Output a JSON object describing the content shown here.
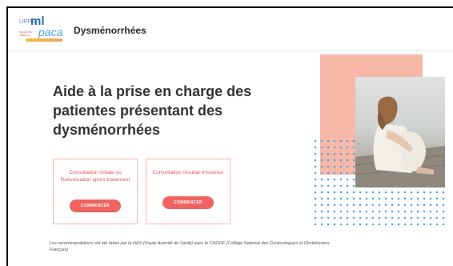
{
  "header": {
    "logo": {
      "urps": "URPS",
      "ml": "ml",
      "paca": "paca",
      "sub": "MÉDECINS LIBÉRAUX"
    },
    "title": "Dysménorrhées"
  },
  "main": {
    "headline": "Aide à la prise en charge des patientes présentant des dysménorrhées",
    "cards": [
      {
        "label": "Consultation initiale ou Réévaluation après traitement",
        "button": "COMMENCER"
      },
      {
        "label": "Consultation résultat d'examen",
        "button": "COMMENCER"
      }
    ],
    "footnote": "Les recommandations ont été faites par la HAS (Haute Autorité de Santé) avec le CNGOF (Collège National des Gynécologues et Obstétriciens Français)"
  },
  "colors": {
    "accent": "#ef6460",
    "card_border": "#f2b7b0",
    "deco_rect": "#f7b8a8",
    "dots": "#4aa3df"
  },
  "icons": {
    "hero": "woman-sitting-photo"
  }
}
